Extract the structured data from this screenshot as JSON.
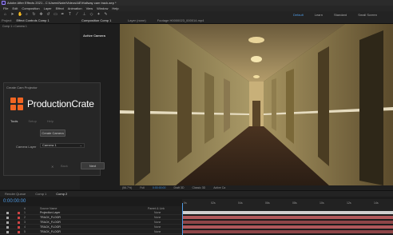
{
  "window": {
    "title": "Adobe After Effects 2021 - C:\\Users\\Nate\\Videos\\AE\\Hallway cam track.aep *"
  },
  "menu": [
    "File",
    "Edit",
    "Composition",
    "Layer",
    "Effect",
    "Animation",
    "View",
    "Window",
    "Help"
  ],
  "workspaces": [
    "Default",
    "Learn",
    "Standard",
    "Small Screen"
  ],
  "left_panel": {
    "tabs": [
      "Project",
      "Effect Controls Comp 1"
    ],
    "sub_label": "Comp 1 • Camera 1"
  },
  "mid_panel": {
    "tabs": [
      "Composition Comp 1"
    ],
    "label": "Active Camera"
  },
  "viewer_tabs": [
    "Layer (none)",
    "Footage H0000023_000014.mp4"
  ],
  "dialog": {
    "title": "Create Cam Projector",
    "brand": "ProductionCrate",
    "tabs": [
      "Tools",
      "Setup",
      "Help"
    ],
    "create_label": "Create Camera",
    "camera_label": "Camera Layer",
    "camera_value": "Camera 1",
    "back_label": "Back",
    "next_label": "Next"
  },
  "viewer_footer": {
    "zoom": "(56.7%)",
    "res": "Full",
    "time": "0:00:00:00",
    "draft": "Draft 3D",
    "renderer": "Classic 3D",
    "camera": "Active Ca"
  },
  "timeline": {
    "tabs": [
      "Render Queue",
      "Comp 1",
      "Comp 2"
    ],
    "timecode": "0:00:00:00",
    "columns": [
      "#",
      "Source Name",
      "Parent & Link"
    ],
    "layers": [
      {
        "num": "1",
        "name": "Projection Layer",
        "parent": "None"
      },
      {
        "num": "2",
        "name": "TRACK_FLOOR",
        "parent": "None"
      },
      {
        "num": "3",
        "name": "TRACK_FLOOR",
        "parent": "None"
      },
      {
        "num": "4",
        "name": "TRACK_FLOOR",
        "parent": "None"
      },
      {
        "num": "5",
        "name": "TRACK_FLOOR",
        "parent": "None"
      }
    ],
    "ruler": [
      "0s",
      "02s",
      "04s",
      "06s",
      "08s",
      "10s",
      "12s",
      "14s"
    ]
  },
  "colors": {
    "accent": "#4f9ce7",
    "brand_orange": "#f26522",
    "layer_bar": "#b0585b"
  }
}
